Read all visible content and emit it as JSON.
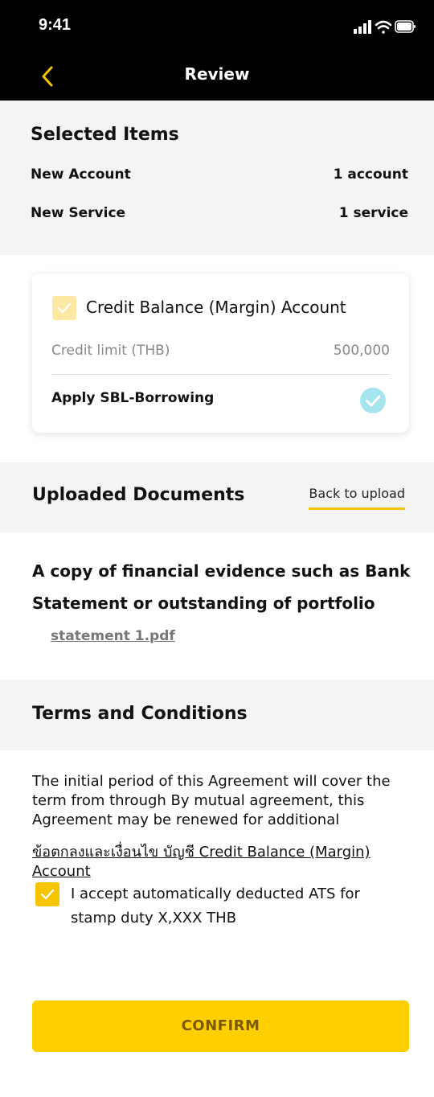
{
  "status_bar": {
    "time": "9:41"
  },
  "nav": {
    "title": "Review"
  },
  "selected_items": {
    "title": "Selected Items",
    "rows": [
      {
        "label": "New Account",
        "value": "1 account"
      },
      {
        "label": "New Service",
        "value": "1 service"
      }
    ]
  },
  "account_card": {
    "title": "Credit Balance (Margin) Account",
    "credit_label": "Credit limit (THB)",
    "credit_value": "500,000",
    "sbl_label": "Apply SBL-Borrowing",
    "checkbox_color": "#fde9a4",
    "sbl_check_color": "#a6e4ee"
  },
  "uploaded_documents": {
    "title": "Uploaded Documents",
    "back_label": "Back to upload",
    "description": "A copy of financial evidence such as Bank Statement or outstanding of portfolio",
    "file_name": "statement 1.pdf"
  },
  "terms": {
    "title": "Terms and Conditions",
    "body": "The initial period of this Agreement will cover the term from through By mutual agreement, this Agreement may be renewed for additional",
    "link": "ข้อตกลงและเงื่อนไข บัญชี Credit Balance (Margin) Account",
    "accept_text": "I accept automatically deducted ATS for stamp duty X,XXX THB"
  },
  "confirm": {
    "label": "CONFIRM"
  },
  "colors": {
    "accent": "#ffcf00",
    "nav_bg": "#000000",
    "back_arrow": "#f7c400",
    "section_bg": "#f4f4f4"
  }
}
